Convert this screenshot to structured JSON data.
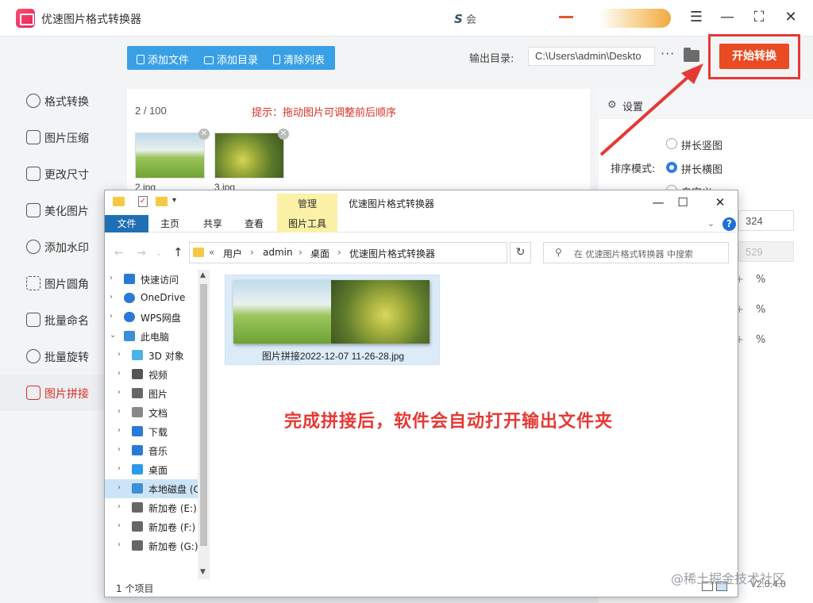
{
  "app": {
    "title": "优速图片格式转换器",
    "mini_logo_letter": "S",
    "mini_logo_text": "会",
    "version": "V2.0.4.0",
    "watermark": "@稀土掘金技术社区"
  },
  "sidebar": {
    "items": [
      {
        "label": "格式转换",
        "icon": "swap-icon"
      },
      {
        "label": "图片压缩",
        "icon": "compress-icon"
      },
      {
        "label": "更改尺寸",
        "icon": "resize-icon"
      },
      {
        "label": "美化图片",
        "icon": "beautify-icon"
      },
      {
        "label": "添加水印",
        "icon": "watermark-icon"
      },
      {
        "label": "图片圆角",
        "icon": "rounded-corner-icon"
      },
      {
        "label": "批量命名",
        "icon": "rename-icon"
      },
      {
        "label": "批量旋转",
        "icon": "rotate-icon"
      },
      {
        "label": "图片拼接",
        "icon": "stitch-icon",
        "active": true
      }
    ]
  },
  "toolbar": {
    "add_file": "添加文件",
    "add_folder": "添加目录",
    "clear_list": "清除列表",
    "output_label": "输出目录:",
    "output_path": "C:\\Users\\admin\\Deskto",
    "more": "···",
    "start": "开始转换"
  },
  "list": {
    "count": "2 / 100",
    "hint": "提示：拖动图片可调整前后顺序",
    "files": [
      {
        "name": "2.jpg"
      },
      {
        "name": "3.jpg"
      }
    ]
  },
  "settings": {
    "title": "设置",
    "sort_label": "排序模式:",
    "options": [
      "拼长竖图",
      "拼长横图",
      "自定义"
    ],
    "selected": "拼长横图",
    "width": "324",
    "height": "529",
    "unit": "%"
  },
  "explorer": {
    "title": "优速图片格式转换器",
    "manage_tab": "管理",
    "ribbon_tabs": [
      "文件",
      "主页",
      "共享",
      "查看",
      "图片工具"
    ],
    "breadcrumb": [
      "用户",
      "admin",
      "桌面",
      "优速图片格式转换器"
    ],
    "search_placeholder": "在 优速图片格式转换器 中搜索",
    "tree": [
      {
        "label": "快速访问",
        "icon": "star-icon",
        "color": "#2b79d6"
      },
      {
        "label": "OneDrive",
        "icon": "cloud-icon",
        "color": "#2b79d6"
      },
      {
        "label": "WPS网盘",
        "icon": "cloud-icon",
        "color": "#2b79d6"
      },
      {
        "label": "此电脑",
        "icon": "pc-icon",
        "color": "#3b8ed8"
      },
      {
        "label": "3D 对象",
        "icon": "cube-icon",
        "color": "#4ab3e8"
      },
      {
        "label": "视频",
        "icon": "video-icon",
        "color": "#555555"
      },
      {
        "label": "图片",
        "icon": "pictures-icon",
        "color": "#666666"
      },
      {
        "label": "文档",
        "icon": "documents-icon",
        "color": "#888888"
      },
      {
        "label": "下载",
        "icon": "download-icon",
        "color": "#2b79d6"
      },
      {
        "label": "音乐",
        "icon": "music-icon",
        "color": "#2b79d6"
      },
      {
        "label": "桌面",
        "icon": "desktop-icon",
        "color": "#2b9ae8"
      },
      {
        "label": "本地磁盘 (C",
        "icon": "drive-c-icon",
        "color": "#3b8ed8",
        "selected": true
      },
      {
        "label": "新加卷 (E:)",
        "icon": "drive-icon",
        "color": "#666666"
      },
      {
        "label": "新加卷 (F:)",
        "icon": "drive-icon",
        "color": "#666666"
      },
      {
        "label": "新加卷 (G:)",
        "icon": "drive-icon",
        "color": "#666666"
      }
    ],
    "file": {
      "name": "图片拼接2022-12-07 11-26-28.jpg"
    },
    "caption": "完成拼接后，软件会自动打开输出文件夹",
    "status": "1 个项目"
  },
  "colors": {
    "accent_red": "#ea4b22",
    "highlight_red": "#e53935",
    "toolbar_blue": "#3aa0e6",
    "explorer_blue": "#1f6fb5"
  }
}
